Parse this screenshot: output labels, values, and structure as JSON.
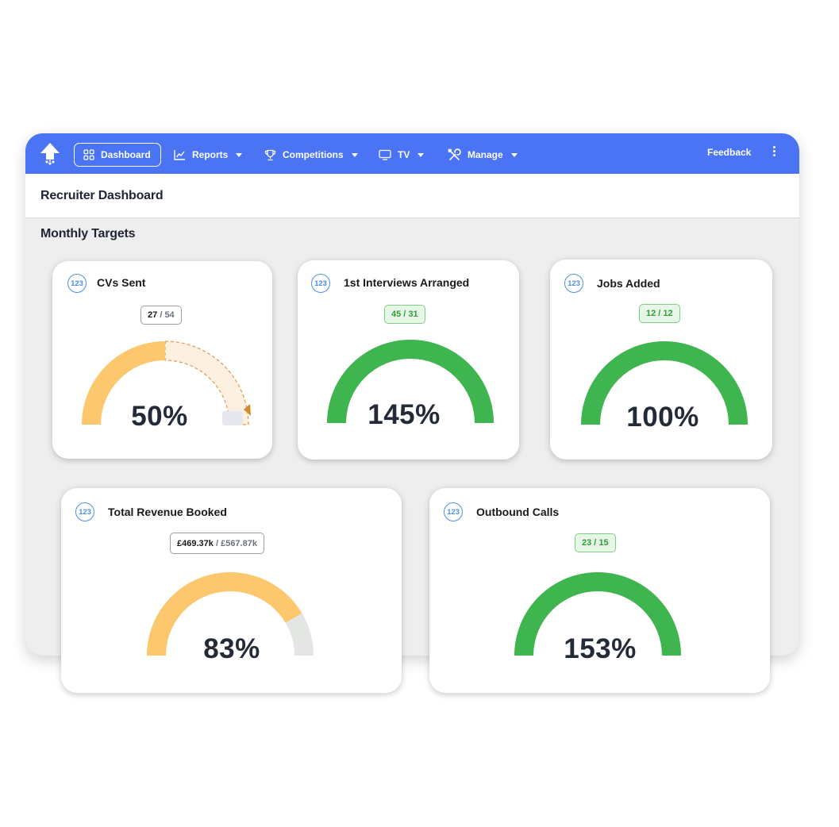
{
  "nav": {
    "items": [
      {
        "label": "Dashboard",
        "active": true
      },
      {
        "label": "Reports"
      },
      {
        "label": "Competitions"
      },
      {
        "label": "TV"
      },
      {
        "label": "Manage"
      }
    ],
    "feedback": "Feedback"
  },
  "page": {
    "title": "Recruiter Dashboard",
    "section": "Monthly Targets"
  },
  "colors": {
    "accent": "#4a74f4",
    "good": "#3fb54f",
    "progress": "#fcc76d",
    "remaining": "#e4e6e4"
  },
  "cards": [
    {
      "badge": "123",
      "title": "CVs Sent",
      "actual": "27",
      "target": "54",
      "percent_text": "50%",
      "fraction": 0.5,
      "status": "under"
    },
    {
      "badge": "123",
      "title": "1st Interviews Arranged",
      "actual": "45",
      "target": "31",
      "percent_text": "145%",
      "fraction": 1.0,
      "status": "met"
    },
    {
      "badge": "123",
      "title": "Jobs Added",
      "actual": "12",
      "target": "12",
      "percent_text": "100%",
      "fraction": 1.0,
      "status": "met"
    },
    {
      "badge": "123",
      "title": "Total Revenue Booked",
      "actual": "£469.37k",
      "target": "£567.87k",
      "percent_text": "83%",
      "fraction": 0.83,
      "status": "under"
    },
    {
      "badge": "123",
      "title": "Outbound Calls",
      "actual": "23",
      "target": "15",
      "percent_text": "153%",
      "fraction": 1.0,
      "status": "met"
    }
  ]
}
